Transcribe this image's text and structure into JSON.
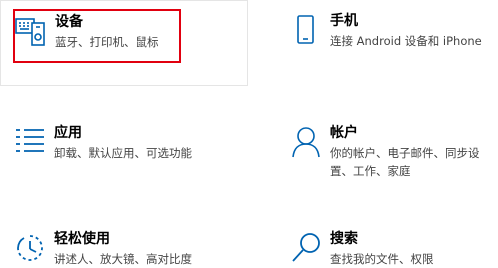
{
  "accent_color": "#0063b1",
  "highlight_color": "#e1000f",
  "tiles": [
    {
      "title": "设备",
      "desc": "蓝牙、打印机、鼠标",
      "icon": "keyboard-device-icon"
    },
    {
      "title": "手机",
      "desc": "连接 Android 设备和 iPhone",
      "icon": "phone-icon"
    },
    {
      "title": "应用",
      "desc": "卸载、默认应用、可选功能",
      "icon": "apps-list-icon"
    },
    {
      "title": "帐户",
      "desc": "你的帐户、电子邮件、同步设置、工作、家庭",
      "icon": "person-icon"
    },
    {
      "title": "轻松使用",
      "desc": "讲述人、放大镜、高对比度",
      "icon": "ease-of-access-icon"
    },
    {
      "title": "搜索",
      "desc": "查找我的文件、权限",
      "icon": "search-icon"
    }
  ]
}
